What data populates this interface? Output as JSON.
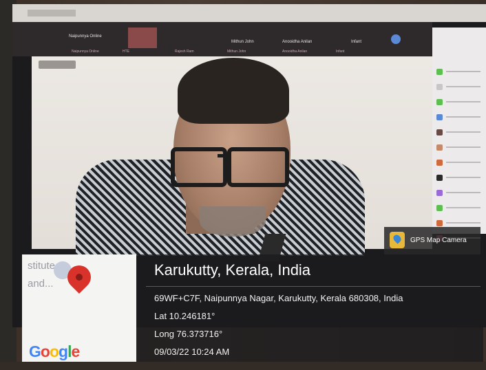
{
  "meeting": {
    "header_name": "Naipunnya Online",
    "participants_top": [
      "Mithun John",
      "Anooidha Anilan",
      "Infant"
    ],
    "participant_tags": [
      "Naipunnya Online",
      "HTE",
      "Rajesh Ram",
      "Mithun John",
      "Anooidha Anilan",
      "Infant"
    ]
  },
  "gps_app": {
    "app_name": "GPS Map Camera",
    "place_title": "Karukutty, Kerala, India",
    "address": "69WF+C7F, Naipunnya Nagar, Karukutty, Kerala 680308, India",
    "lat": "Lat 10.246181°",
    "long": "Long 76.373716°",
    "datetime": "09/03/22 10:24 AM",
    "map_label_1": "stitute",
    "map_label_2": "and...",
    "map_brand": "Google",
    "brand_colors": [
      "#4285f4",
      "#ea4335",
      "#fbbc05",
      "#4285f4",
      "#34a853",
      "#ea4335"
    ],
    "pin_color": "#d8322b",
    "pin_icon": "map-pin-icon"
  },
  "chat_colors": [
    "#5cbf4f",
    "#c9c6c8",
    "#5cbf4f",
    "#5a8ad6",
    "#6a4a44",
    "#c48a6a",
    "#d06a3a",
    "#2a2a2a",
    "#9a6ad6",
    "#5cbf4f",
    "#d06a3a",
    "#d66a8a"
  ]
}
